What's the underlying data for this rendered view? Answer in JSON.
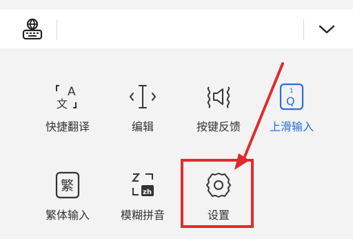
{
  "toolbar": {
    "keyboard_icon": "keyboard-globe-icon",
    "collapse_icon": "chevron-down-icon"
  },
  "menu": {
    "items": [
      {
        "label": "快捷翻译",
        "icon": "translate-icon"
      },
      {
        "label": "编辑",
        "icon": "text-cursor-icon"
      },
      {
        "label": "按键反馈",
        "icon": "key-feedback-icon"
      },
      {
        "label": "上滑输入",
        "icon": "swipe-up-input-icon"
      },
      {
        "label": "繁体输入",
        "icon": "traditional-chinese-icon"
      },
      {
        "label": "模糊拼音",
        "icon": "fuzzy-pinyin-icon"
      },
      {
        "label": "设置",
        "icon": "settings-gear-icon"
      }
    ],
    "badges": {
      "traditional": "繁",
      "fuzzy": "zh",
      "swipe_digit": "1",
      "swipe_letter": "Q",
      "translate_a": "A",
      "translate_wen": "文"
    }
  },
  "colors": {
    "accent": "#2a6ed6",
    "highlight": "#e12b2b",
    "icon": "#333333"
  }
}
